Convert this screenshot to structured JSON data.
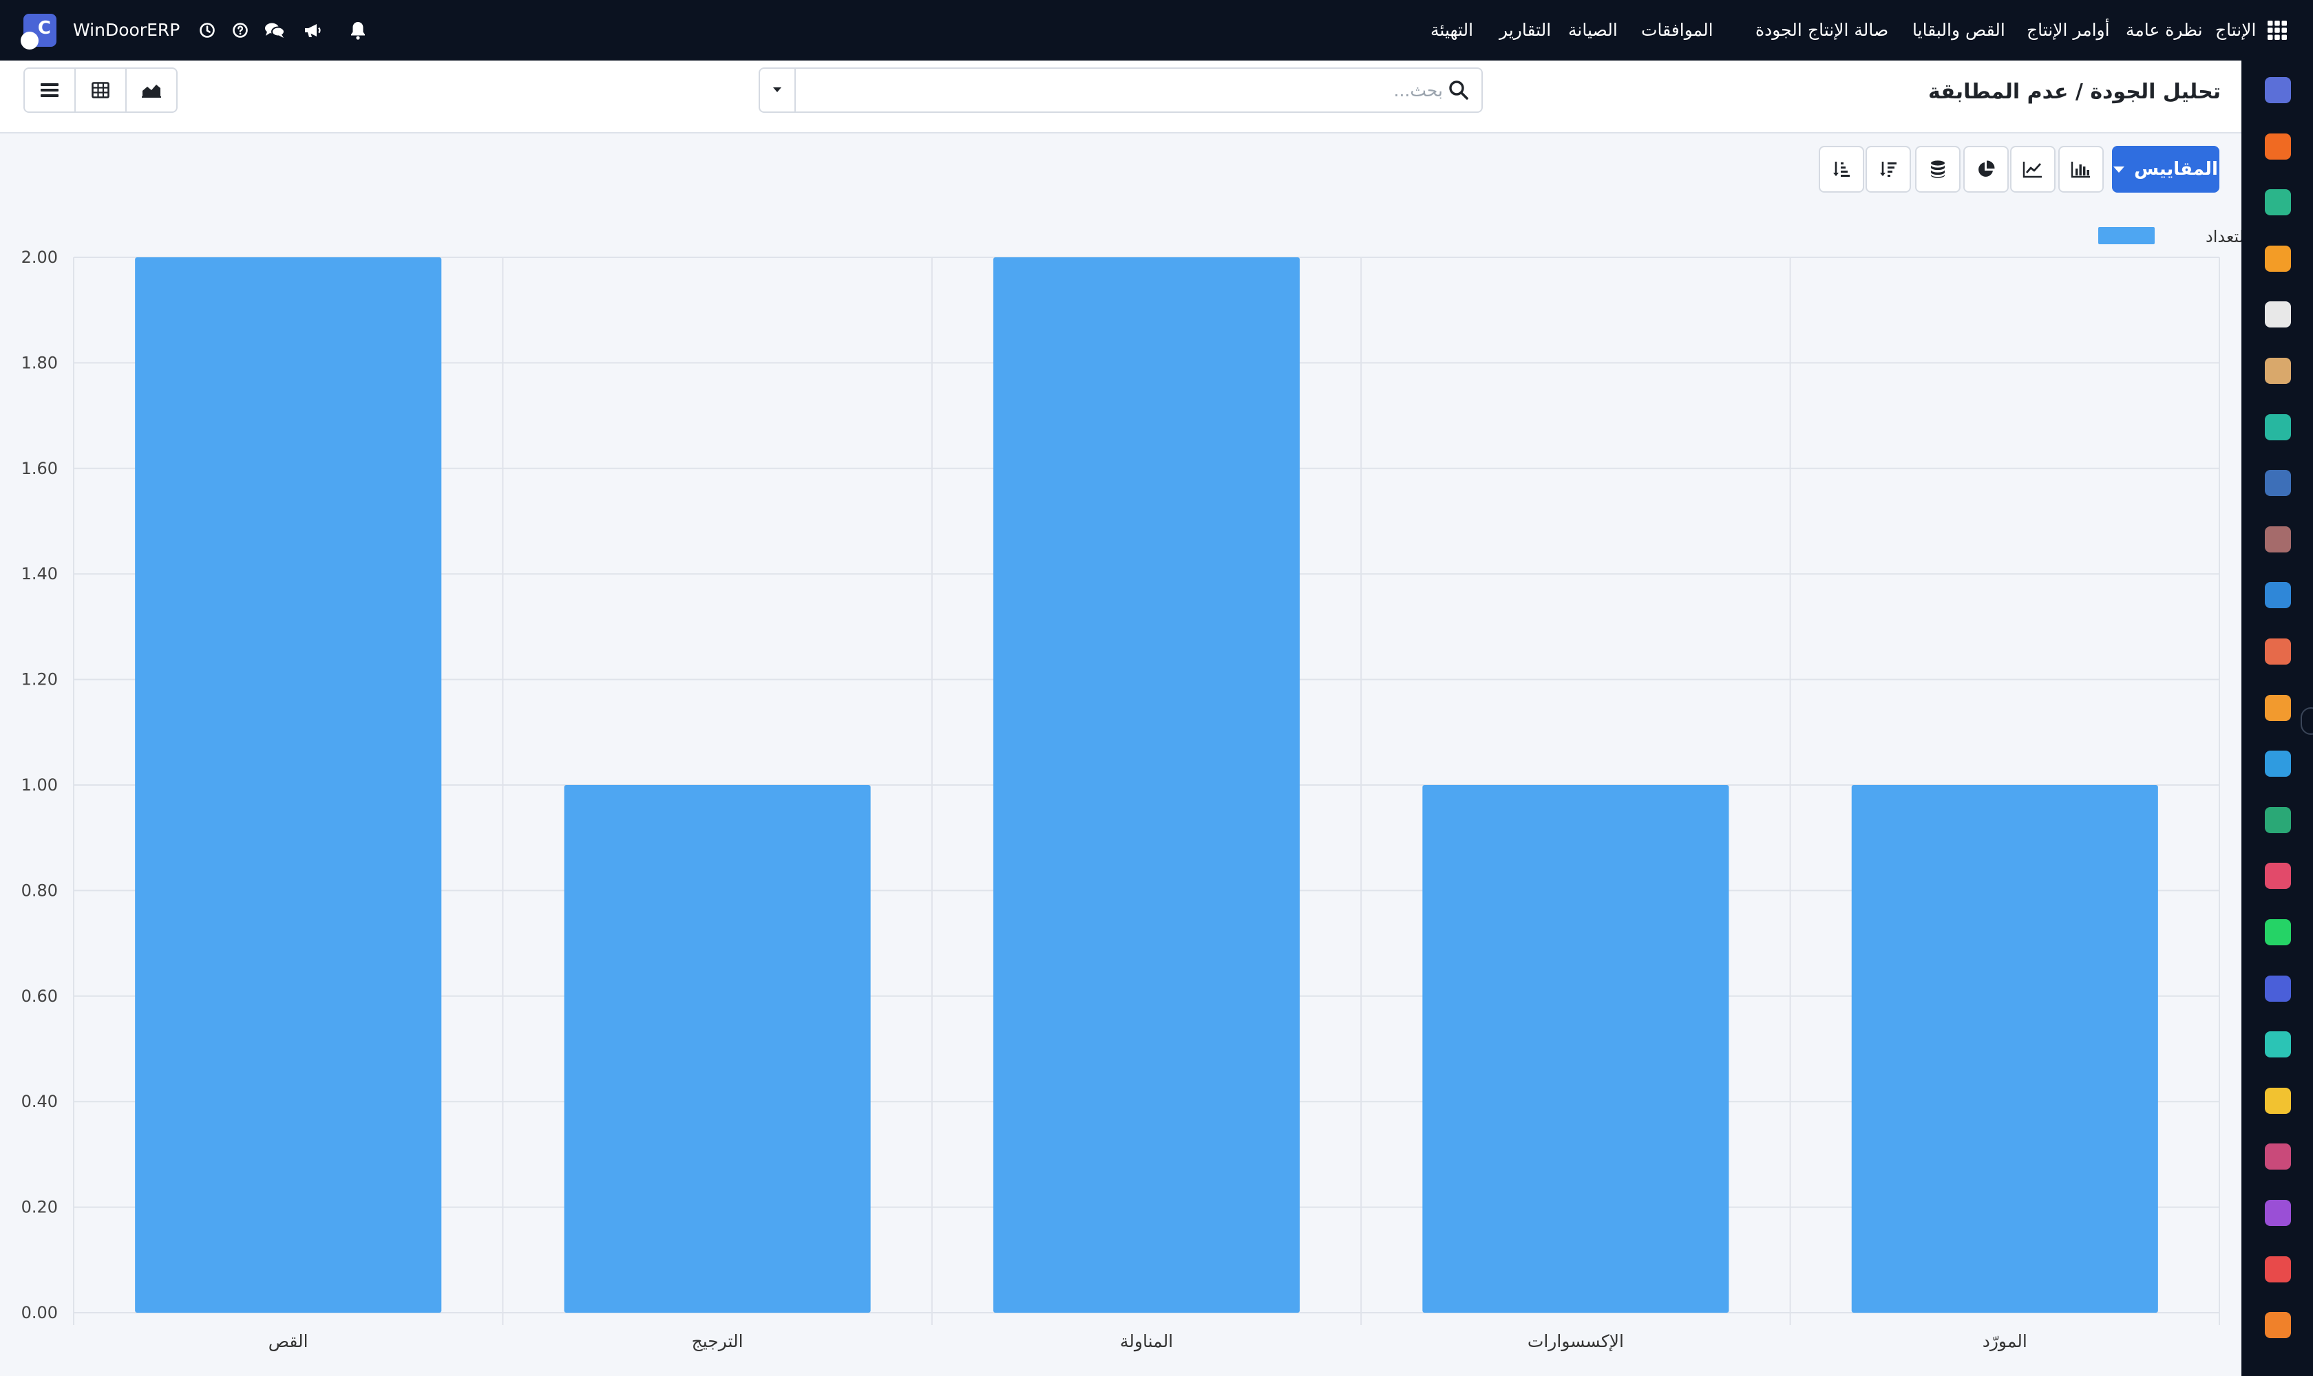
{
  "navbar": {
    "app_name": "WinDoorERP",
    "menu_items": [
      "الإنتاج",
      "نظرة عامة",
      "أوامر الإنتاج",
      "القص والبقايا",
      "صالة الإنتاج",
      "الجودة",
      "الموافقات",
      "الصيانة",
      "التقارير",
      "التهيئة"
    ],
    "icons": [
      "apps-grid-icon",
      "bell-icon",
      "megaphone-icon",
      "chat-icon",
      "help-icon",
      "clock-icon"
    ]
  },
  "control_panel": {
    "breadcrumb": "تحليل الجودة / عدم المطابقة",
    "search_placeholder": "بحث...",
    "view_buttons": [
      "list-view",
      "pivot-view",
      "graph-view"
    ]
  },
  "graph_toolbar": {
    "measures_label": "المقاييس",
    "chart_type_buttons": [
      "bar-chart",
      "line-chart",
      "pie-chart"
    ],
    "option_buttons": [
      "stacked",
      "sort-descending",
      "sort-ascending"
    ]
  },
  "sidebar": {
    "apps": [
      {
        "icon": "mail-app-icon",
        "color": "#5b6fd8"
      },
      {
        "icon": "discuss-app-icon",
        "color": "#f06a22"
      },
      {
        "icon": "validation-app-icon",
        "color": "#2bb58a"
      },
      {
        "icon": "dashboard-app-icon",
        "color": "#f39c26"
      },
      {
        "icon": "inventory-app-icon",
        "color": "#e8e8e8"
      },
      {
        "icon": "quality-app-icon",
        "color": "#d9a86b"
      },
      {
        "icon": "tasks-app-icon",
        "color": "#27b7a0"
      },
      {
        "icon": "knowledge-app-icon",
        "color": "#3d6fb8"
      },
      {
        "icon": "product-app-icon",
        "color": "#a56b6b"
      },
      {
        "icon": "invoicing-app-icon",
        "color": "#2f87d8"
      },
      {
        "icon": "employees-app-icon",
        "color": "#e66a4a"
      },
      {
        "icon": "calendar-app-icon",
        "color": "#f29a2e"
      },
      {
        "icon": "sign-app-icon",
        "color": "#2f9be0"
      },
      {
        "icon": "contacts-app-icon",
        "color": "#2aa876"
      },
      {
        "icon": "apps-app-icon",
        "color": "#e24a6a"
      },
      {
        "icon": "whatsapp-app-icon",
        "color": "#25d366"
      },
      {
        "icon": "timer-app-icon",
        "color": "#4a5fd9"
      },
      {
        "icon": "wave-app-icon",
        "color": "#2bc4b5"
      },
      {
        "icon": "send-app-icon",
        "color": "#f2c230"
      },
      {
        "icon": "payroll-app-icon",
        "color": "#c94a7a"
      },
      {
        "icon": "hexagon-app-icon",
        "color": "#9a4fd6"
      },
      {
        "icon": "chart-app-icon",
        "color": "#e84a4a"
      },
      {
        "icon": "settings-app-icon",
        "color": "#f0812a"
      }
    ]
  },
  "chart_data": {
    "type": "bar",
    "categories": [
      "القص",
      "الترجيج",
      "المناولة",
      "الإكسسوارات",
      "المورّد"
    ],
    "series": [
      {
        "name": "التعداد",
        "values": [
          2,
          1,
          2,
          1,
          1
        ],
        "color": "#4ea6f2"
      }
    ],
    "yticks": [
      "0.00",
      "0.20",
      "0.40",
      "0.60",
      "0.80",
      "1.00",
      "1.20",
      "1.40",
      "1.60",
      "1.80",
      "2.00"
    ],
    "ylim": [
      0,
      2
    ],
    "grid": true,
    "legend_position": "top-right"
  }
}
